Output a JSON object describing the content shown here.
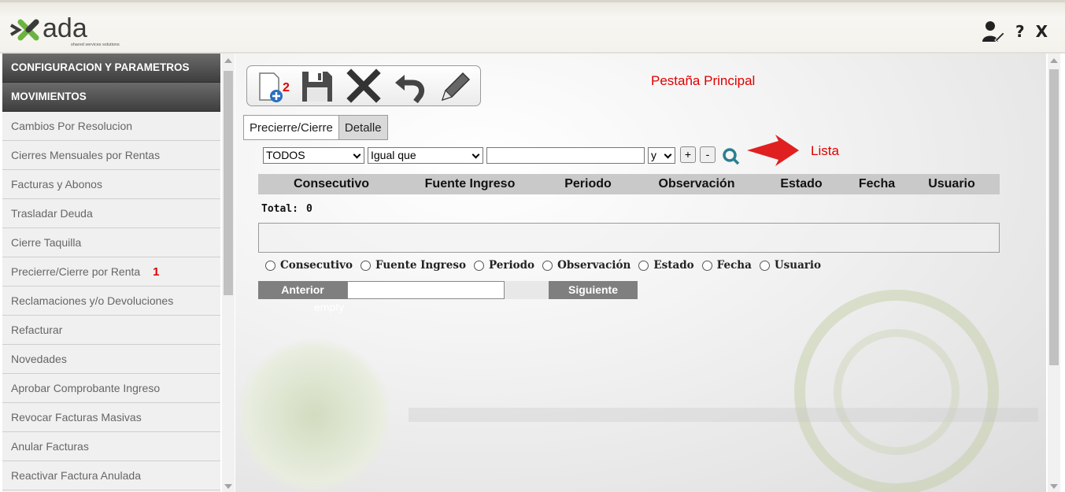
{
  "header": {
    "logo_text": "ada",
    "logo_tagline": "shared services solutions",
    "help_label": "?",
    "close_label": "X"
  },
  "sidebar": {
    "sections": [
      "CONFIGURACION Y PARAMETROS",
      "MOVIMIENTOS"
    ],
    "items": [
      {
        "label": "Cambios Por Resolucion"
      },
      {
        "label": "Cierres Mensuales por Rentas"
      },
      {
        "label": "Facturas y Abonos"
      },
      {
        "label": "Trasladar Deuda"
      },
      {
        "label": "Cierre Taquilla"
      },
      {
        "label": "Precierre/Cierre por Renta",
        "marker": "1"
      },
      {
        "label": "Reclamaciones y/o Devoluciones"
      },
      {
        "label": "Refacturar"
      },
      {
        "label": "Novedades"
      },
      {
        "label": "Aprobar Comprobante Ingreso"
      },
      {
        "label": "Revocar Facturas Masivas"
      },
      {
        "label": "Anular Facturas"
      },
      {
        "label": "Reactivar Factura Anulada"
      }
    ]
  },
  "toolbar": {
    "marker": "2",
    "buttons": [
      "new-document-icon",
      "save-icon",
      "delete-icon",
      "undo-icon",
      "edit-icon"
    ]
  },
  "annotations": {
    "title": "Pestaña Principal",
    "lista": "Lista"
  },
  "tabs": [
    {
      "label": "Precierre/Cierre",
      "active": true
    },
    {
      "label": "Detalle",
      "active": false
    }
  ],
  "filter": {
    "field_select": "TODOS",
    "operator_select": "Igual que",
    "value": "",
    "logic_select": "y",
    "add_label": "+",
    "remove_label": "-"
  },
  "table": {
    "columns": [
      "Consecutivo",
      "Fuente Ingreso",
      "Periodo",
      "Observación",
      "Estado",
      "Fecha",
      "Usuario"
    ],
    "total_label": "Total:",
    "total_value": "0"
  },
  "sort_options": [
    "Consecutivo",
    "Fuente Ingreso",
    "Periodo",
    "Observación",
    "Estado",
    "Fecha",
    "Usuario"
  ],
  "pager": {
    "prev_label": "Anterior",
    "next_label": "Siguiente",
    "page_value": "",
    "empty_text": "empty"
  },
  "colors": {
    "annotation_red": "#e00000",
    "menu_header_bg": "#4a4a4a",
    "table_header_bg": "#c9c9c9",
    "pager_button_bg": "#7f7f7f"
  }
}
